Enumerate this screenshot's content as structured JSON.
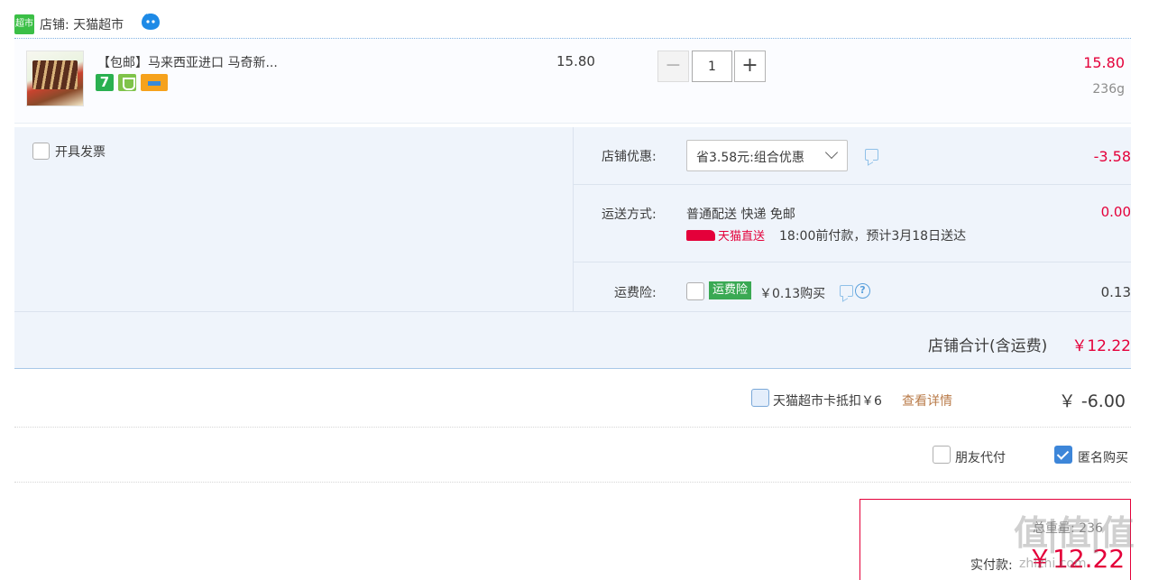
{
  "shop": {
    "logo_text": "超市",
    "label": "店铺: 天猫超市"
  },
  "item": {
    "title": "【包邮】马来西亚进口 马奇新...",
    "badge_seven": "7",
    "unit_price": "15.80",
    "quantity": "1",
    "minus_label": "−",
    "plus_label": "+",
    "total": "15.80",
    "weight": "236g"
  },
  "options": {
    "invoice_label": "开具发票",
    "shop_discount_label": "店铺优惠:",
    "shop_discount_select": "省3.58元:组合优惠",
    "shop_discount_amount": "-3.58",
    "shipping_label": "运送方式:",
    "shipping_method": "普通配送 快递 免邮",
    "tmall_direct": "天猫直送",
    "shipping_eta": "18:00前付款，预计3月18日送达",
    "shipping_amount": "0.00",
    "insurance_label": "运费险:",
    "insurance_tag": "运费险",
    "insurance_price": "￥0.13购买",
    "insurance_help": "?",
    "insurance_amount": "0.13",
    "shop_total_label": "店铺合计(含运费)",
    "shop_total_value": "￥12.22"
  },
  "card": {
    "label": "天猫超市卡抵扣￥6",
    "detail_link": "查看详情",
    "amount": "￥ -6.00"
  },
  "extras": {
    "friend_pay_label": "朋友代付",
    "anonymous_label": "匿名购买"
  },
  "payment": {
    "weight_label": "总重量: 236",
    "pay_label": "实付款:",
    "pay_value": "￥12.22"
  },
  "watermark": {
    "text": "值|值|值",
    "site": "zhizhi.com"
  },
  "colors": {
    "price_red": "#e4003a",
    "tmall_green": "#3aa953",
    "link_brown": "#b97b49",
    "checkbox_blue": "#3d86d9"
  }
}
